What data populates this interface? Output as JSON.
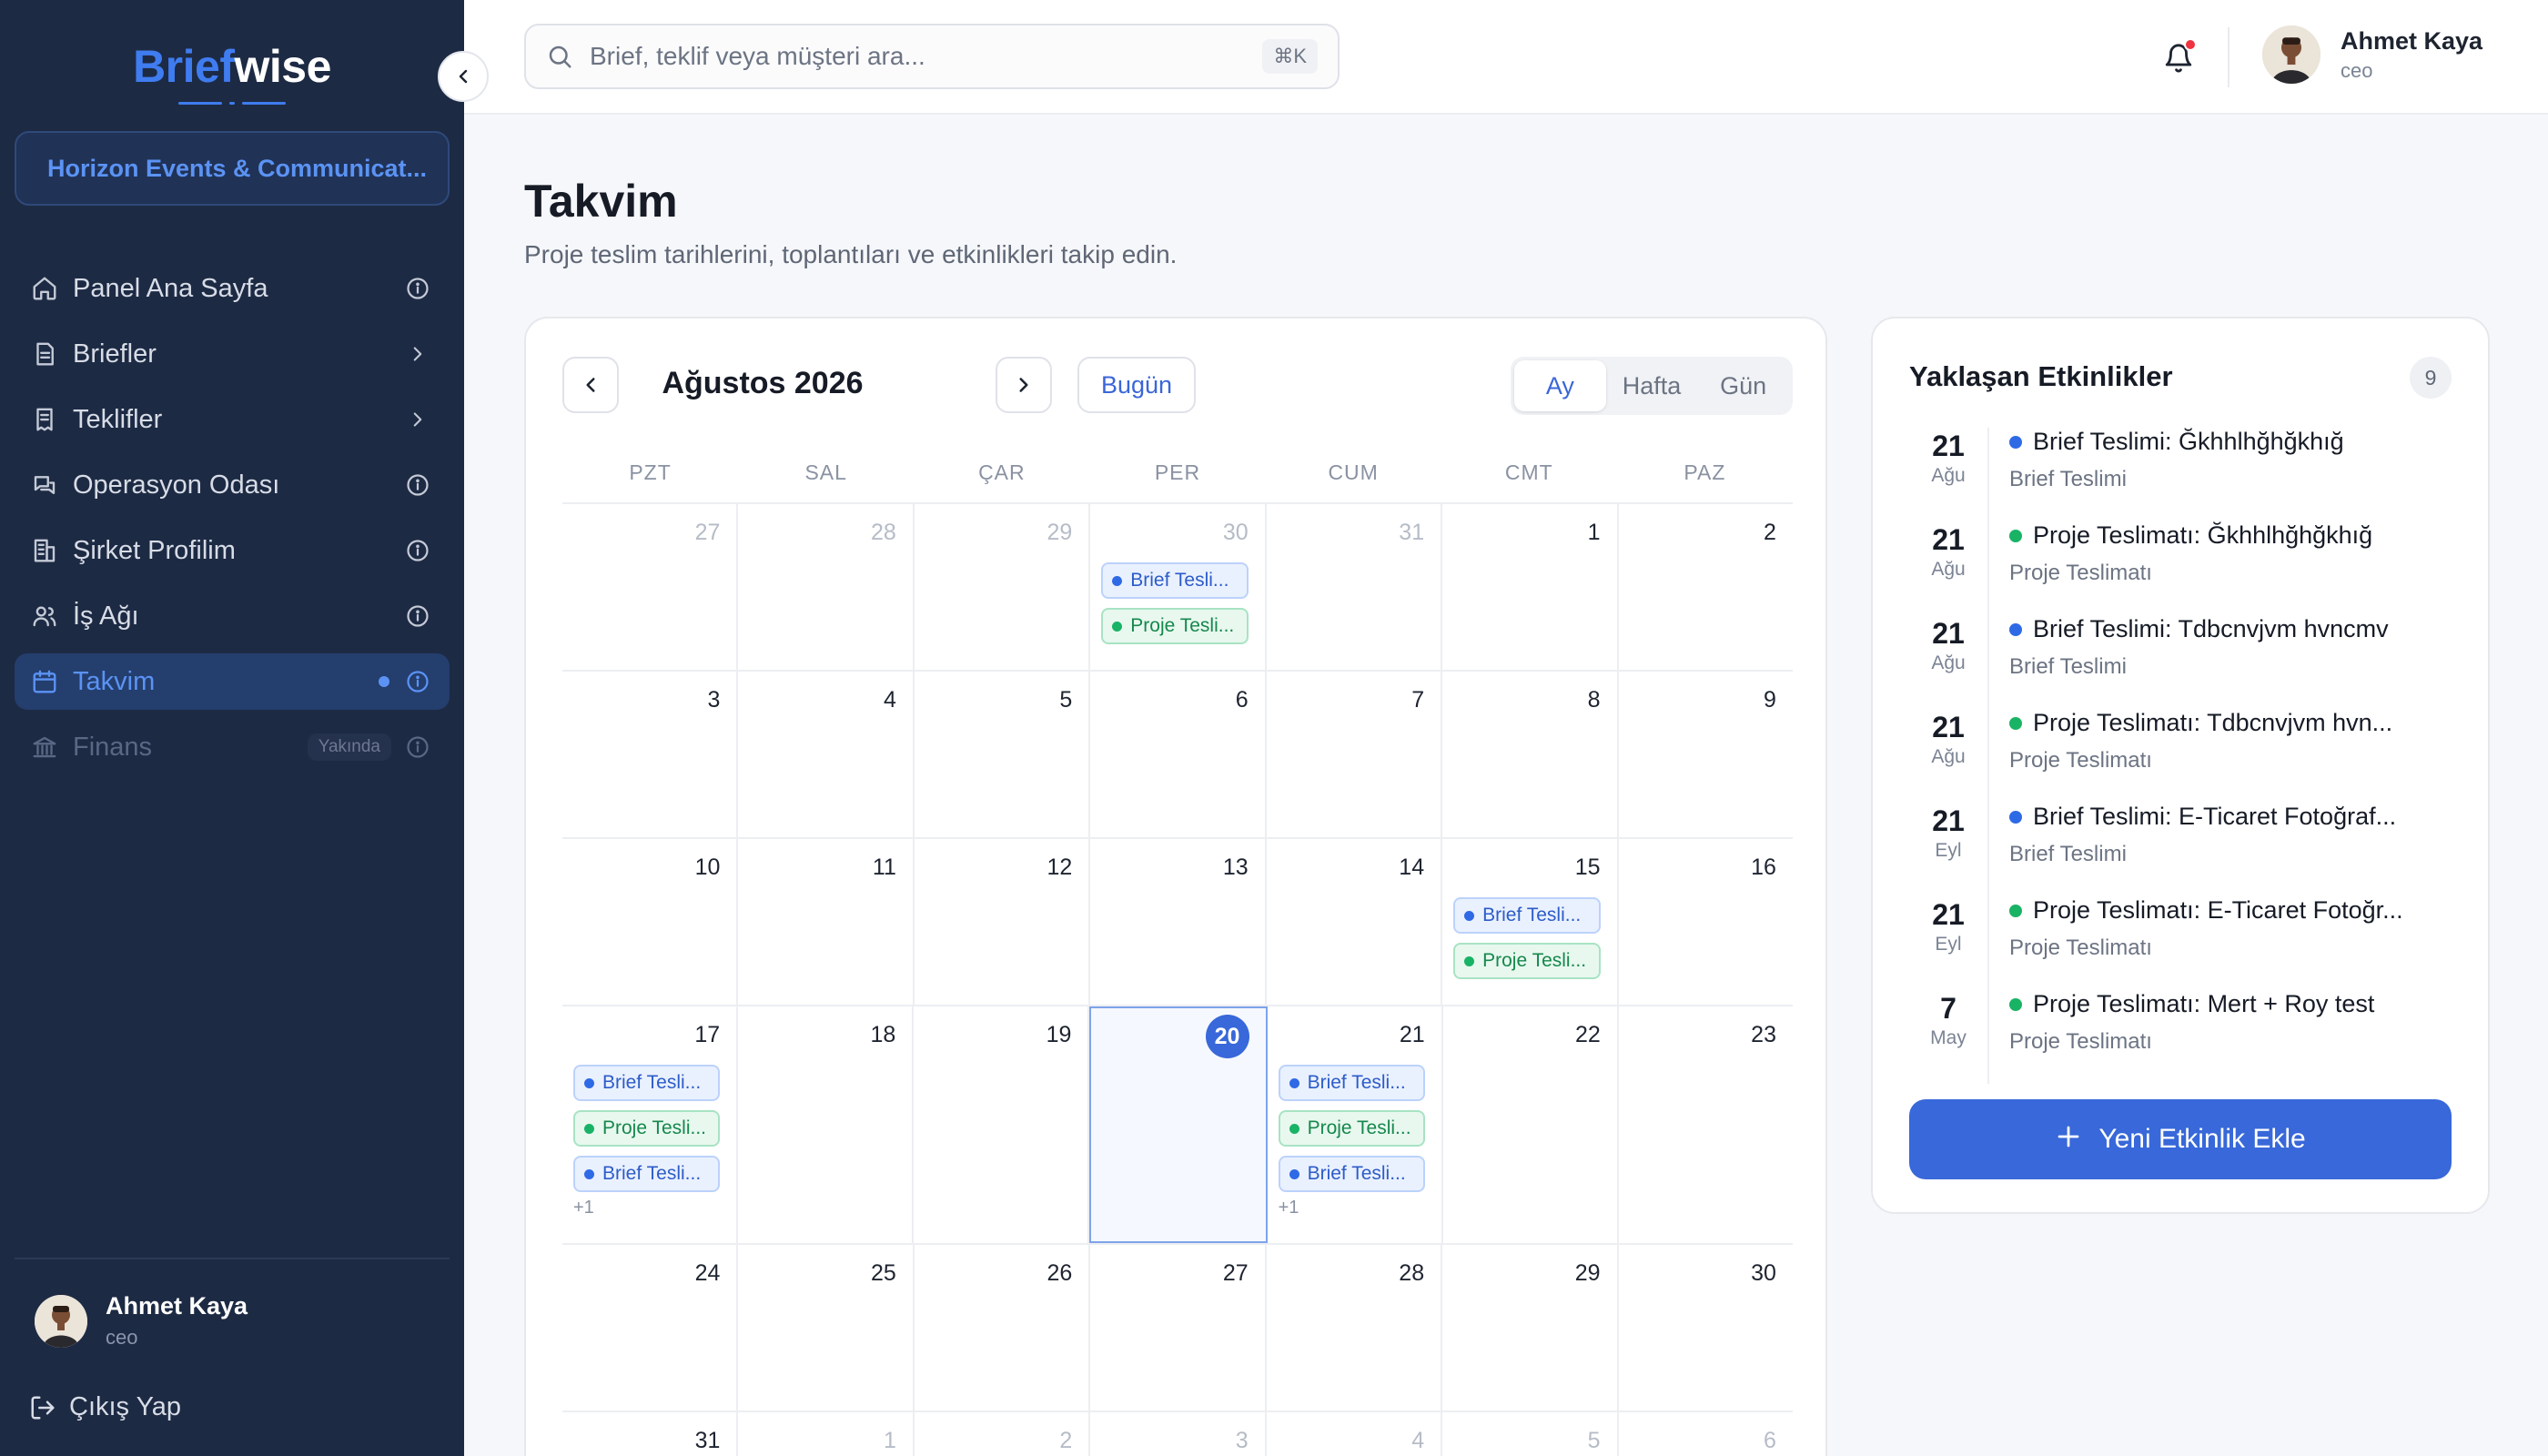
{
  "brand": {
    "part1": "Brief",
    "part2": "wise"
  },
  "organization": "Horizon Events & Communicat...",
  "nav": [
    {
      "label": "Panel Ana Sayfa",
      "icon": "home-icon",
      "right": "info",
      "state": "normal"
    },
    {
      "label": "Briefler",
      "icon": "document-icon",
      "right": "chevron",
      "state": "normal"
    },
    {
      "label": "Teklifler",
      "icon": "receipt-icon",
      "right": "chevron",
      "state": "normal"
    },
    {
      "label": "Operasyon Odası",
      "icon": "chat-icon",
      "right": "info",
      "state": "normal"
    },
    {
      "label": "Şirket Profilim",
      "icon": "building-icon",
      "right": "info",
      "state": "normal"
    },
    {
      "label": "İş Ağı",
      "icon": "users-icon",
      "right": "info",
      "state": "normal"
    },
    {
      "label": "Takvim",
      "icon": "calendar-icon",
      "right": "info",
      "state": "active"
    },
    {
      "label": "Finans",
      "icon": "bank-icon",
      "right": "info",
      "state": "disabled",
      "badge": "Yakında"
    }
  ],
  "user": {
    "name": "Ahmet Kaya",
    "role": "ceo"
  },
  "logout_label": "Çıkış Yap",
  "search": {
    "placeholder": "Brief, teklif veya müşteri ara...",
    "shortcut": "⌘K"
  },
  "page": {
    "title": "Takvim",
    "subtitle": "Proje teslim tarihlerini, toplantıları ve etkinlikleri takip edin."
  },
  "calendar": {
    "month_label": "Ağustos 2026",
    "today_label": "Bugün",
    "views": [
      "Ay",
      "Hafta",
      "Gün"
    ],
    "selected_view": "Ay",
    "weekdays": [
      "PZT",
      "SAL",
      "ÇAR",
      "PER",
      "CUM",
      "CMT",
      "PAZ"
    ],
    "weeks": [
      [
        {
          "d": "27",
          "muted": true
        },
        {
          "d": "28",
          "muted": true
        },
        {
          "d": "29",
          "muted": true
        },
        {
          "d": "30",
          "muted": true,
          "events": [
            {
              "label": "Brief Tesli...",
              "color": "blue"
            },
            {
              "label": "Proje Tesli...",
              "color": "green"
            }
          ]
        },
        {
          "d": "31",
          "muted": true
        },
        {
          "d": "1"
        },
        {
          "d": "2"
        }
      ],
      [
        {
          "d": "3"
        },
        {
          "d": "4"
        },
        {
          "d": "5"
        },
        {
          "d": "6"
        },
        {
          "d": "7"
        },
        {
          "d": "8"
        },
        {
          "d": "9"
        }
      ],
      [
        {
          "d": "10"
        },
        {
          "d": "11"
        },
        {
          "d": "12"
        },
        {
          "d": "13"
        },
        {
          "d": "14"
        },
        {
          "d": "15",
          "events": [
            {
              "label": "Brief Tesli...",
              "color": "blue"
            },
            {
              "label": "Proje Tesli...",
              "color": "green"
            }
          ]
        },
        {
          "d": "16"
        }
      ],
      [
        {
          "d": "17",
          "events": [
            {
              "label": "Brief Tesli...",
              "color": "blue"
            },
            {
              "label": "Proje Tesli...",
              "color": "green"
            },
            {
              "label": "Brief Tesli...",
              "color": "blue"
            }
          ],
          "more": "+1"
        },
        {
          "d": "18"
        },
        {
          "d": "19"
        },
        {
          "d": "20",
          "today": true
        },
        {
          "d": "21",
          "events": [
            {
              "label": "Brief Tesli...",
              "color": "blue"
            },
            {
              "label": "Proje Tesli...",
              "color": "green"
            },
            {
              "label": "Brief Tesli...",
              "color": "blue"
            }
          ],
          "more": "+1"
        },
        {
          "d": "22"
        },
        {
          "d": "23"
        }
      ],
      [
        {
          "d": "24"
        },
        {
          "d": "25"
        },
        {
          "d": "26"
        },
        {
          "d": "27"
        },
        {
          "d": "28"
        },
        {
          "d": "29"
        },
        {
          "d": "30"
        }
      ],
      [
        {
          "d": "31"
        },
        {
          "d": "1",
          "muted": true
        },
        {
          "d": "2",
          "muted": true
        },
        {
          "d": "3",
          "muted": true
        },
        {
          "d": "4",
          "muted": true
        },
        {
          "d": "5",
          "muted": true
        },
        {
          "d": "6",
          "muted": true
        }
      ]
    ]
  },
  "upcoming": {
    "title": "Yaklaşan Etkinlikler",
    "count": "9",
    "items": [
      {
        "day": "21",
        "month": "Ağu",
        "title": "Brief Teslimi: Ğkhhlhğhğkhığ",
        "type": "Brief Teslimi",
        "color": "blue"
      },
      {
        "day": "21",
        "month": "Ağu",
        "title": "Proje Teslimatı: Ğkhhlhğhğkhığ",
        "type": "Proje Teslimatı",
        "color": "green"
      },
      {
        "day": "21",
        "month": "Ağu",
        "title": "Brief Teslimi: Tdbcnvjvm hvncmv",
        "type": "Brief Teslimi",
        "color": "blue"
      },
      {
        "day": "21",
        "month": "Ağu",
        "title": "Proje Teslimatı: Tdbcnvjvm hvn...",
        "type": "Proje Teslimatı",
        "color": "green"
      },
      {
        "day": "21",
        "month": "Eyl",
        "title": "Brief Teslimi: E-Ticaret Fotoğraf...",
        "type": "Brief Teslimi",
        "color": "blue"
      },
      {
        "day": "21",
        "month": "Eyl",
        "title": "Proje Teslimatı: E-Ticaret Fotoğr...",
        "type": "Proje Teslimatı",
        "color": "green"
      },
      {
        "day": "7",
        "month": "May",
        "title": "Proje Teslimatı: Mert + Roy test",
        "type": "Proje Teslimatı",
        "color": "green"
      }
    ],
    "add_label": "Yeni Etkinlik Ekle"
  },
  "colors": {
    "accent": "#3868d9",
    "sidebar": "#1d2a44",
    "event_blue": "#2f6ae6",
    "event_green": "#19b365",
    "notification": "#ef3340"
  }
}
